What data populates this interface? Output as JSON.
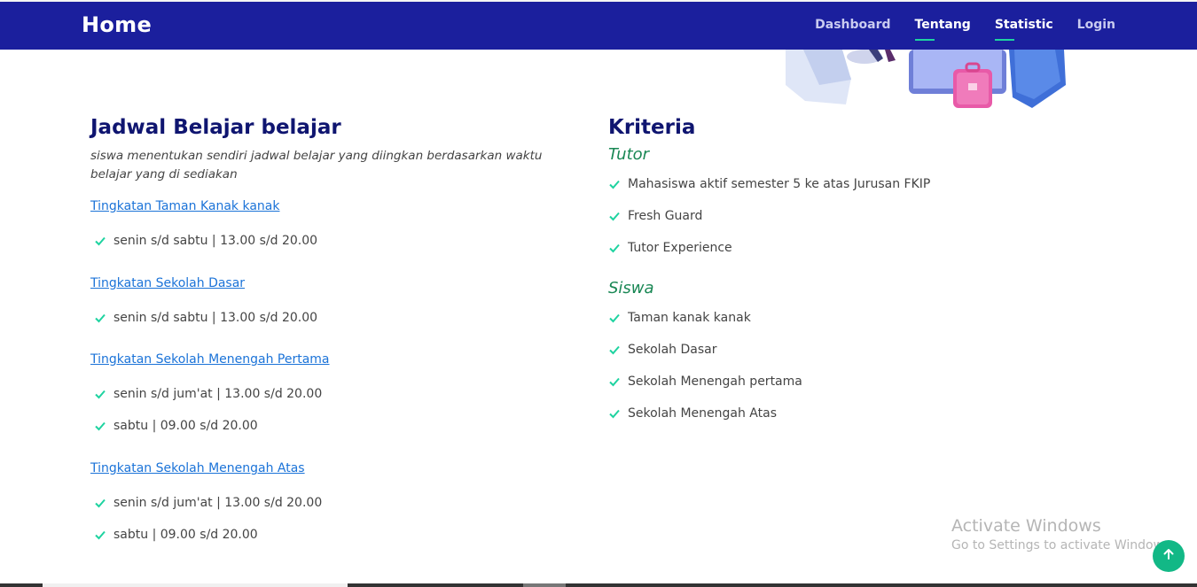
{
  "navbar": {
    "brand": "Home",
    "links": [
      {
        "label": "Dashboard",
        "active": false
      },
      {
        "label": "Tentang",
        "active": true
      },
      {
        "label": "Statistic",
        "active": true
      },
      {
        "label": "Login",
        "active": false
      }
    ]
  },
  "schedule": {
    "title": "Jadwal Belajar belajar",
    "description": "siswa menentukan sendiri jadwal belajar yang diingkan berdasarkan waktu belajar yang di sediakan",
    "levels": [
      {
        "name": "Tingkatan Taman Kanak kanak",
        "items": [
          "senin s/d sabtu | 13.00 s/d 20.00"
        ]
      },
      {
        "name": "Tingkatan Sekolah Dasar",
        "items": [
          "senin s/d sabtu | 13.00 s/d 20.00"
        ]
      },
      {
        "name": "Tingkatan Sekolah Menengah Pertama",
        "items": [
          "senin s/d jum'at | 13.00 s/d 20.00",
          "sabtu | 09.00 s/d 20.00"
        ]
      },
      {
        "name": "Tingkatan Sekolah Menengah Atas",
        "items": [
          "senin s/d jum'at | 13.00 s/d 20.00",
          "sabtu | 09.00 s/d 20.00"
        ]
      }
    ]
  },
  "criteria": {
    "title": "Kriteria",
    "tutor": {
      "heading": "Tutor",
      "items": [
        "Mahasiswa aktif semester 5 ke atas Jurusan FKIP",
        "Fresh Guard",
        "Tutor Experience"
      ]
    },
    "siswa": {
      "heading": "Siswa",
      "items": [
        "Taman kanak kanak",
        "Sekolah Dasar",
        "Sekolah Menengah pertama",
        "Sekolah Menengah Atas"
      ]
    }
  },
  "watermark": {
    "line1": "Activate Windows",
    "line2": "Go to Settings to activate Windows."
  },
  "icons": {
    "check": "check-icon",
    "back_to_top": "arrow-up-icon"
  },
  "colors": {
    "navbar_bg": "#1b1f9d",
    "title": "#0f1570",
    "link_blue": "#1b73d8",
    "accent_green": "#1ed3a0",
    "subhead_green": "#198754",
    "back_to_top": "#12b886"
  }
}
